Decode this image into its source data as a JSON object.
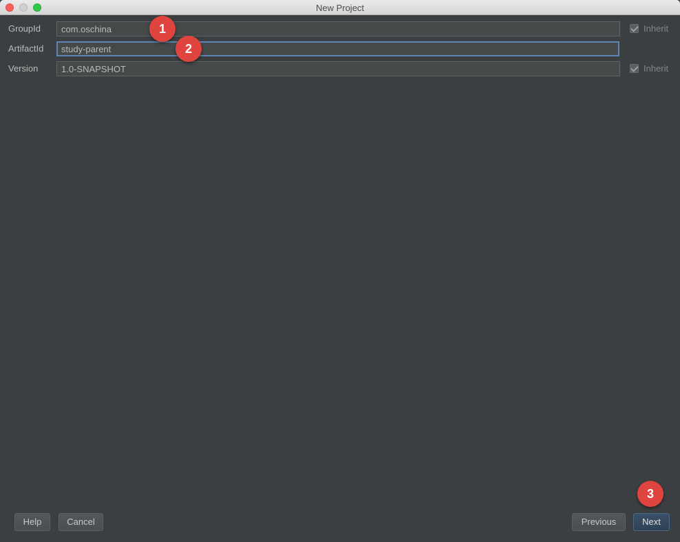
{
  "window": {
    "title": "New Project"
  },
  "form": {
    "group_id": {
      "label": "GroupId",
      "value": "com.oschina",
      "inherit_label": "Inherit"
    },
    "artifact_id": {
      "label": "ArtifactId",
      "value": "study-parent"
    },
    "version": {
      "label": "Version",
      "value": "1.0-SNAPSHOT",
      "inherit_label": "Inherit"
    }
  },
  "annotations": [
    "1",
    "2",
    "3"
  ],
  "buttons": {
    "help": "Help",
    "cancel": "Cancel",
    "previous": "Previous",
    "next": "Next"
  },
  "colors": {
    "background": "#3c3f41",
    "field_bg": "#45494a",
    "focus_border": "#5d85b2",
    "badge": "#e0443e"
  }
}
